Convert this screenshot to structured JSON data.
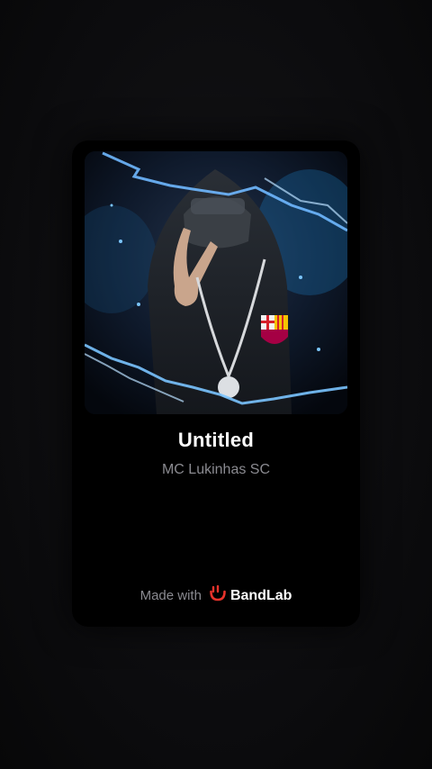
{
  "track": {
    "title": "Untitled",
    "artist": "MC Lukinhas SC"
  },
  "footer": {
    "made_with_label": "Made with",
    "brand_name": "BandLab"
  },
  "colors": {
    "background": "#0d0d0f",
    "card": "#000000",
    "title": "#ffffff",
    "secondary_text": "#8a8a90",
    "brand_accent": "#e8332b",
    "lightning": "#6fb8ff"
  },
  "icons": {
    "brand_logo": "bandlab-logo-icon"
  }
}
